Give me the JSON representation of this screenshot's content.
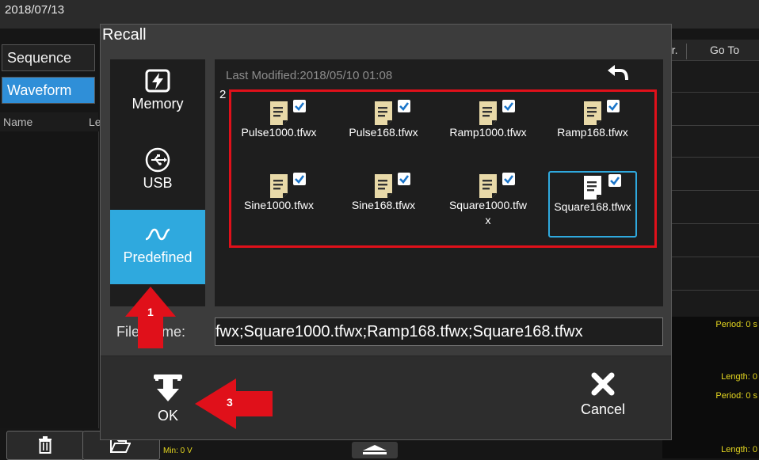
{
  "background": {
    "date": "2018/07/13",
    "tabs": {
      "sequence": "Sequence",
      "waveform": "Waveform"
    },
    "list_header": {
      "name": "Name",
      "length": "Le"
    },
    "table_header": {
      "addr": "dr.",
      "goto": "Go To"
    },
    "side_values": {
      "period1": "Period: 0 s",
      "length1": "Length: 0",
      "period2": "Period: 0 s",
      "length2": "Length: 0",
      "min": "Min: 0 V"
    }
  },
  "dialog": {
    "title": "Recall",
    "sources": [
      {
        "label": "Memory",
        "icon": "memory-icon",
        "active": false
      },
      {
        "label": "USB",
        "icon": "usb-icon",
        "active": false
      },
      {
        "label": "Predefined",
        "icon": "waveform-icon",
        "active": true
      }
    ],
    "last_modified": "Last Modified:2018/05/10 01:08",
    "count_prefix": "2",
    "files": [
      {
        "name": "Pulse1000.tfwx",
        "checked": true,
        "selected": false
      },
      {
        "name": "Pulse168.tfwx",
        "checked": true,
        "selected": false
      },
      {
        "name": "Ramp1000.tfwx",
        "checked": true,
        "selected": false
      },
      {
        "name": "Ramp168.tfwx",
        "checked": true,
        "selected": false
      },
      {
        "name": "Sine1000.tfwx",
        "checked": true,
        "selected": false
      },
      {
        "name": "Sine168.tfwx",
        "checked": true,
        "selected": false
      },
      {
        "name": "Square1000.tfwx",
        "checked": true,
        "selected": false
      },
      {
        "name": "Square168.tfwx",
        "checked": true,
        "selected": true
      }
    ],
    "file_name_label": "File Name:",
    "file_name_value": "fwx;Square1000.tfwx;Ramp168.tfwx;Square168.tfwx",
    "ok_label": "OK",
    "cancel_label": "Cancel"
  },
  "annotations": [
    {
      "number": "1",
      "target": "Predefined"
    },
    {
      "number": "2",
      "target": "file selection"
    },
    {
      "number": "3",
      "target": "OK"
    }
  ],
  "colors": {
    "accent": "#2fa9de",
    "annotation_red": "#e0101a",
    "dialog_bg": "#3c3c3c",
    "panel_bg": "#1e1e1e"
  }
}
